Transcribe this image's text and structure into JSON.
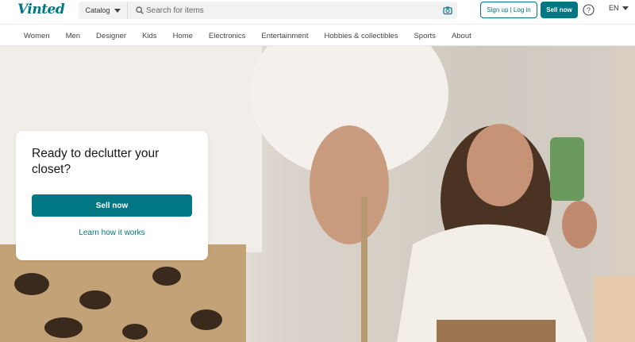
{
  "brand": {
    "logo_text": "Vinted",
    "accent": "#007782"
  },
  "header": {
    "catalog_label": "Catalog",
    "search_placeholder": "Search for items",
    "signup_label": "Sign up | Log in",
    "sell_label": "Sell now",
    "language": "EN",
    "icons": [
      "search-icon",
      "camera-icon",
      "help-icon",
      "chevron-down-icon"
    ]
  },
  "nav": {
    "items": [
      "Women",
      "Men",
      "Designer",
      "Kids",
      "Home",
      "Electronics",
      "Entertainment",
      "Hobbies & collectibles",
      "Sports",
      "About"
    ]
  },
  "hero": {
    "title": "Ready to declutter your closet?",
    "cta_label": "Sell now",
    "link_label": "Learn how it works"
  }
}
